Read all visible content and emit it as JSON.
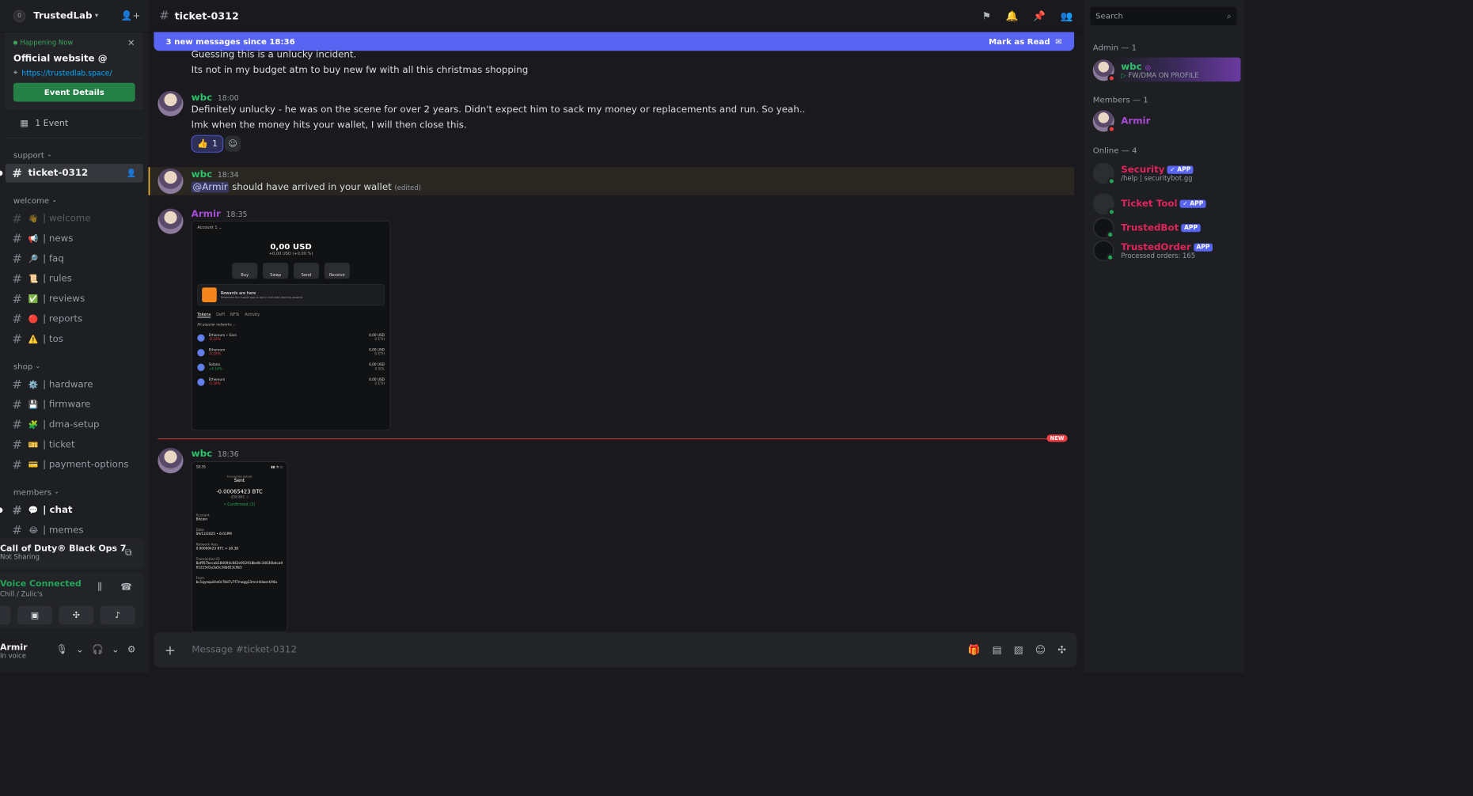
{
  "server": {
    "name": "TrustedLab",
    "badge": "0"
  },
  "event": {
    "tag": "Happening Now",
    "title": "Official website @",
    "link": "https://trustedlab.space/",
    "button": "Event Details",
    "count": "1 Event"
  },
  "categories": {
    "support": "support",
    "welcome": "welcome",
    "shop": "shop",
    "members": "members"
  },
  "channels": {
    "ticket": "ticket-0312",
    "welcome": [
      {
        "emoji": "👋",
        "name": "| welcome"
      },
      {
        "emoji": "📢",
        "name": "| news"
      },
      {
        "emoji": "🔎",
        "name": "| faq"
      },
      {
        "emoji": "📜",
        "name": "| rules"
      },
      {
        "emoji": "✅",
        "name": "| reviews"
      },
      {
        "emoji": "🔴",
        "name": "| reports"
      },
      {
        "emoji": "⚠️",
        "name": "| tos"
      }
    ],
    "shop": [
      {
        "emoji": "⚙️",
        "name": "| hardware"
      },
      {
        "emoji": "💾",
        "name": "| firmware"
      },
      {
        "emoji": "🧩",
        "name": "| dma-setup"
      },
      {
        "emoji": "🎫",
        "name": "| ticket"
      },
      {
        "emoji": "💳",
        "name": "| payment-options"
      }
    ],
    "members": [
      {
        "emoji": "💬",
        "name": "| chat"
      },
      {
        "emoji": "😂",
        "name": "| memes"
      }
    ]
  },
  "activity": {
    "title": "Call of Duty® Black Ops 7",
    "sub": "Not Sharing"
  },
  "voice": {
    "title": "Voice Connected",
    "sub": "Chill / Zulic's"
  },
  "user": {
    "name": "Armir",
    "status": "In voice"
  },
  "chat": {
    "channel": "ticket-0312",
    "newbar": "3 new messages since 18:36",
    "mark_read": "Mark as Read",
    "input_placeholder": "Message #ticket-0312",
    "new_tag": "NEW"
  },
  "messages": {
    "m0": {
      "line1": "Guessing this is a unlucky incident.",
      "line2": "Its not in my budget atm to buy new fw with all this christmas shopping"
    },
    "m1": {
      "user": "wbc",
      "time": "18:00",
      "line1": "Definitely unlucky - he was on the scene for over 2 years. Didn't expect him to sack my money or replacements and run. So yeah..",
      "line2": "lmk when the money hits your wallet, I will then close this.",
      "reaction_emoji": "👍",
      "reaction_count": "1"
    },
    "m2": {
      "user": "wbc",
      "time": "18:34",
      "mention": "@Armir",
      "text": " should have arrived in your wallet ",
      "edited": "(edited)"
    },
    "m3": {
      "user": "Armir",
      "time": "18:35"
    },
    "m4": {
      "user": "wbc",
      "time": "18:36"
    }
  },
  "wallet_shot": {
    "account": "Account 1 ⌄",
    "balance": "0,00 USD",
    "balance_sub": "+0,00 USD (+0,00 %)",
    "buttons": [
      "Buy",
      "Swap",
      "Send",
      "Receive"
    ],
    "reward_title": "Rewards are here",
    "reward_sub": "Download the mobile app to opt in and start earning rewards",
    "tabs": [
      "Tokens",
      "DeFi",
      "NFTs",
      "Activity"
    ],
    "networks": "All popular networks ⌄",
    "tokens": [
      {
        "name": "Ethereum • Earn",
        "change": "-0.22%",
        "usd": "0,00 USD",
        "amt": "0 ETH"
      },
      {
        "name": "Ethereum",
        "change": "-0.10%",
        "usd": "0,00 USD",
        "amt": "0 ETH"
      },
      {
        "name": "Solana",
        "change": "+4.14%",
        "usd": "0,00 USD",
        "amt": "0 SOL"
      },
      {
        "name": "Ethereum",
        "change": "-0.10%",
        "usd": "0,00 USD",
        "amt": "0 ETH"
      }
    ]
  },
  "tx_shot": {
    "time": "18:35",
    "header": "Transaction details",
    "status": "Sent",
    "amount": "-0.00065423 BTC",
    "fiat": "-$58.861 ⓘ",
    "confirmed": "• Confirmed (3)",
    "account_label": "Account",
    "account": "Bitcoin",
    "date_label": "Date",
    "date": "09/12/2025 • 6:01PM",
    "fees_label": "Network fees",
    "fees": "0.00000423 BTC  ≈  $0.38",
    "txid_label": "Transaction ID",
    "txid": "8af957bccab184094c842e952918bd0c34030b4ca901215d1a3a5c3db813c0b5",
    "from_label": "From",
    "from": "bc1qyequkhe0r78d7v7f7magg33mvr4dwerk94a"
  },
  "members": {
    "search": "Search",
    "admin_group": "Admin — 1",
    "members_group": "Members — 1",
    "online_group": "Online — 4",
    "admin": {
      "name": "wbc",
      "sub": "FW/DMA ON PROFILE"
    },
    "member": {
      "name": "Armir"
    },
    "online": [
      {
        "name": "Security",
        "badge": "✓ APP",
        "sub": "/help | securitybot.gg"
      },
      {
        "name": "Ticket Tool",
        "badge": "✓ APP",
        "sub": ""
      },
      {
        "name": "TrustedBot",
        "badge": "APP",
        "sub": ""
      },
      {
        "name": "TrustedOrder",
        "badge": "APP",
        "sub": "Processed orders: 165"
      }
    ]
  }
}
